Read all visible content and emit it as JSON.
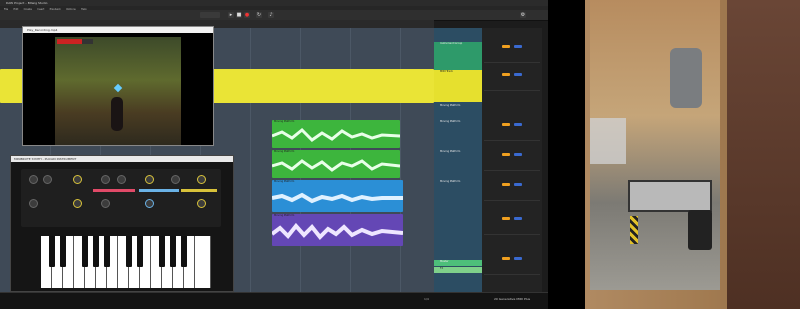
{
  "window": {
    "title": "DAW Project – Bitwig Studio",
    "menu": [
      "File",
      "Edit",
      "Create",
      "Insert",
      "Playback",
      "Options",
      "Help"
    ]
  },
  "transport": {
    "buttons": [
      "play",
      "stop",
      "record",
      "loop",
      "metronome"
    ]
  },
  "game_window": {
    "title": "Play_Recording.mp4"
  },
  "synth_window": {
    "title": "MINIBRUTE SYNTH - PLUGIN INSTRUMENT"
  },
  "tracks": [
    {
      "label": "Instrument Group",
      "color": "#2e9a6a"
    },
    {
      "label": "MIDI Track",
      "color": "#e6e02e"
    },
    {
      "label": "Moving Platform",
      "color": "#28a8c8"
    },
    {
      "label": "Moving Platform",
      "color": "#28a8c8"
    },
    {
      "label": "Moving Platform",
      "color": "#2aa0e0"
    },
    {
      "label": "Moving Platform",
      "color": "#6a4cc0"
    },
    {
      "label": "Master",
      "color": "#4dbf7a"
    },
    {
      "label": "FX",
      "color": "#7fd08a"
    }
  ],
  "clips": [
    {
      "label": "Moving Platform",
      "color": "#3db53d"
    },
    {
      "label": "Moving Platform",
      "color": "#3db53d"
    },
    {
      "label": "Moving Platform",
      "color": "#2b8fd6"
    },
    {
      "label": "Moving Platform",
      "color": "#6447b5"
    }
  ],
  "status": {
    "page": "1/4",
    "selection": "20 Generative MIDI Plus"
  },
  "colors": {
    "yellow_clip": "#eae436",
    "arrange_bg": "#3f4a57",
    "row_labels_bg": "#2c4d63"
  }
}
